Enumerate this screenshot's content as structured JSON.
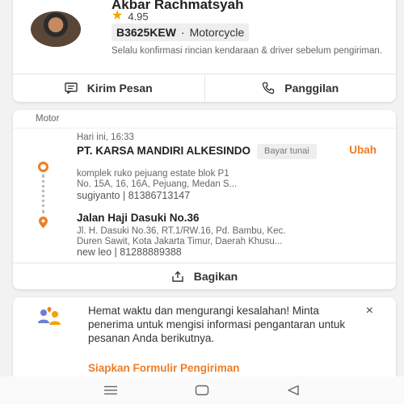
{
  "driver": {
    "name": "Akbar Rachmatsyah",
    "rating": "4.95",
    "plate": "B3625KEW",
    "separator": "·",
    "vehicle_type": "Motorcycle",
    "confirm_text": "Selalu konfirmasi rincian kendaraan & driver sebelum pengiriman.",
    "actions": {
      "message": "Kirim Pesan",
      "call": "Panggilan"
    }
  },
  "route": {
    "mode_label": "Motor",
    "time": "Hari ini, 16:33",
    "pickup": {
      "name": "PT. KARSA MANDIRI ALKESINDO",
      "payment": "Bayar tunai",
      "edit": "Ubah",
      "address_line1": "komplek ruko pejuang estate blok P1",
      "address_line2": "No. 15A, 16, 16A, Pejuang, Medan S...",
      "contact": "sugiyanto | 81386713147"
    },
    "dropoff": {
      "name": "Jalan Haji Dasuki No.36",
      "address_line1": "Jl. H. Dasuki No.36, RT.1/RW.16, Pd. Bambu, Kec.",
      "address_line2": "Duren Sawit, Kota Jakarta Timur, Daerah Khusu...",
      "contact": "new leo | 81288889388"
    },
    "share": "Bagikan"
  },
  "promo": {
    "text": "Hemat waktu dan mengurangi kesalahan! Minta penerima untuk mengisi informasi pengantaran untuk pesanan Anda berikutnya.",
    "link": "Siapkan Formulir Pengiriman",
    "close": "×"
  },
  "colors": {
    "accent": "#f07c25",
    "star": "#f4a300"
  },
  "icons": [
    "star-icon",
    "message-icon",
    "phone-icon",
    "origin-pin-icon",
    "destination-pin-icon",
    "share-icon",
    "people-location-icon",
    "close-icon",
    "menu-nav-icon",
    "home-nav-icon",
    "back-nav-icon"
  ]
}
